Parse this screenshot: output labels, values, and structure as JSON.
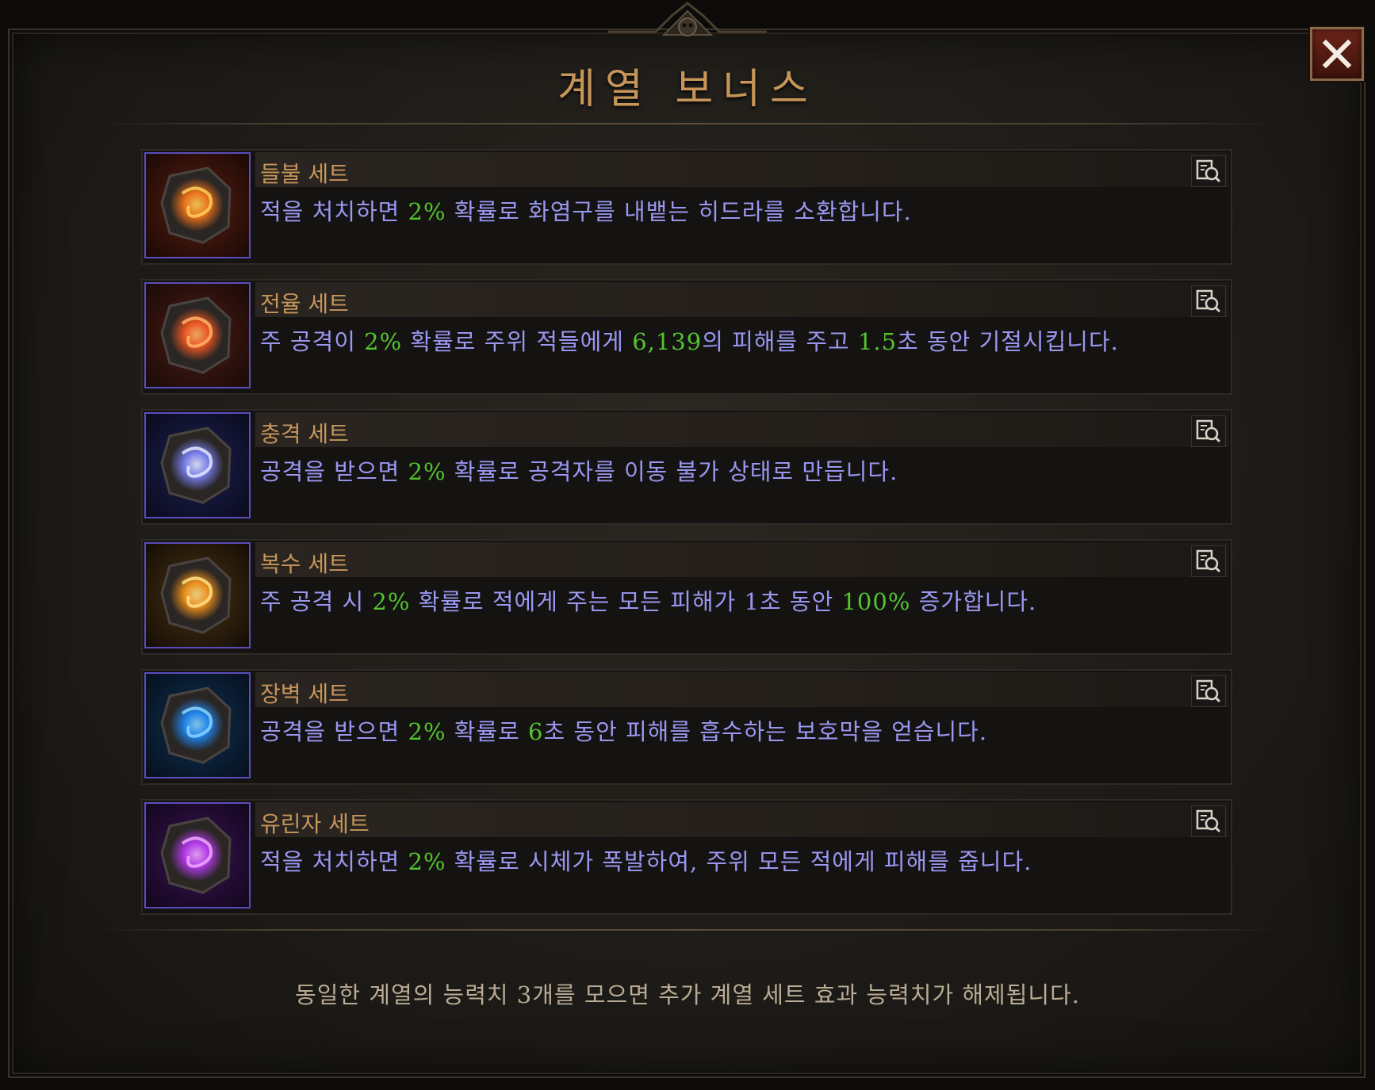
{
  "window": {
    "title": "계열 보너스",
    "close_label": "×"
  },
  "sets": [
    {
      "name": "들불 세트",
      "icon": "fire-dragon-stone-icon",
      "desc": [
        {
          "t": "적을 처치하면 "
        },
        {
          "t": "2%",
          "hl": true
        },
        {
          "t": " 확률로 화염구를 내뱉는 히드라를 소환합니다."
        }
      ]
    },
    {
      "name": "전율 세트",
      "icon": "molten-rune-stone-icon",
      "desc": [
        {
          "t": "주 공격이 "
        },
        {
          "t": "2%",
          "hl": true
        },
        {
          "t": " 확률로 주위 적들에게 "
        },
        {
          "t": "6,139",
          "hl": true
        },
        {
          "t": "의 피해를 주고 "
        },
        {
          "t": "1.5",
          "hl": true
        },
        {
          "t": "초 동안 기절시킵니다."
        }
      ]
    },
    {
      "name": "충격 세트",
      "icon": "lightning-stone-icon",
      "desc": [
        {
          "t": "공격을 받으면 "
        },
        {
          "t": "2%",
          "hl": true
        },
        {
          "t": " 확률로 공격자를 이동 불가 상태로 만듭니다."
        }
      ]
    },
    {
      "name": "복수 세트",
      "icon": "golden-swirl-stone-icon",
      "desc": [
        {
          "t": "주 공격 시 "
        },
        {
          "t": "2%",
          "hl": true
        },
        {
          "t": " 확률로 적에게 주는 모든 피해가 1초 동안 "
        },
        {
          "t": "100%",
          "hl": true
        },
        {
          "t": " 증가합니다."
        }
      ]
    },
    {
      "name": "장벽 세트",
      "icon": "blue-orb-stone-icon",
      "desc": [
        {
          "t": "공격을 받으면 "
        },
        {
          "t": "2%",
          "hl": true
        },
        {
          "t": " 확률로 "
        },
        {
          "t": "6",
          "hl": true
        },
        {
          "t": "초 동안 피해를 흡수하는 보호막을 얻습니다."
        }
      ]
    },
    {
      "name": "유린자 세트",
      "icon": "purple-burst-stone-icon",
      "desc": [
        {
          "t": "적을 처치하면 "
        },
        {
          "t": "2%",
          "hl": true
        },
        {
          "t": " 확률로 시체가 폭발하여, 주위 모든 적에게 피해를 줍니다."
        }
      ]
    }
  ],
  "footer": {
    "note": "동일한 계열의 능력치 3개를 모으면 추가 계열 세트 효과 능력치가 해제됩니다."
  },
  "colors": {
    "title": "#c6955a",
    "description": "#9a97f0",
    "highlight": "#53c42e",
    "footer": "#b9ab94",
    "icon_border": "#5a4dbb"
  }
}
